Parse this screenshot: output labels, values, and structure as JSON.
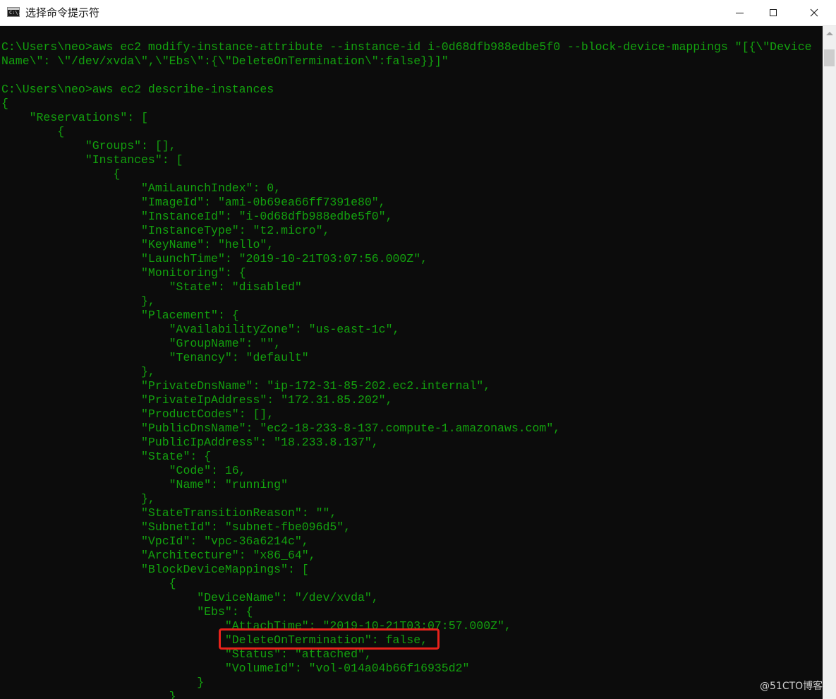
{
  "window": {
    "title": "选择命令提示符",
    "icon_name": "cmd-app-icon",
    "icon_glyph": "C:\\.",
    "controls": [
      "minimize",
      "maximize",
      "close"
    ],
    "close_glyph": "✕"
  },
  "console": {
    "text_color": "#13a10e",
    "background_color": "#0c0c0c",
    "lines": [
      "C:\\Users\\neo>aws ec2 modify-instance-attribute --instance-id i-0d68dfb988edbe5f0 --block-device-mappings \"[{\\\"Device",
      "Name\\\": \\\"/dev/xvda\\\",\\\"Ebs\\\":{\\\"DeleteOnTermination\\\":false}}]\"",
      "",
      "C:\\Users\\neo>aws ec2 describe-instances",
      "{",
      "    \"Reservations\": [",
      "        {",
      "            \"Groups\": [],",
      "            \"Instances\": [",
      "                {",
      "                    \"AmiLaunchIndex\": 0,",
      "                    \"ImageId\": \"ami-0b69ea66ff7391e80\",",
      "                    \"InstanceId\": \"i-0d68dfb988edbe5f0\",",
      "                    \"InstanceType\": \"t2.micro\",",
      "                    \"KeyName\": \"hello\",",
      "                    \"LaunchTime\": \"2019-10-21T03:07:56.000Z\",",
      "                    \"Monitoring\": {",
      "                        \"State\": \"disabled\"",
      "                    },",
      "                    \"Placement\": {",
      "                        \"AvailabilityZone\": \"us-east-1c\",",
      "                        \"GroupName\": \"\",",
      "                        \"Tenancy\": \"default\"",
      "                    },",
      "                    \"PrivateDnsName\": \"ip-172-31-85-202.ec2.internal\",",
      "                    \"PrivateIpAddress\": \"172.31.85.202\",",
      "                    \"ProductCodes\": [],",
      "                    \"PublicDnsName\": \"ec2-18-233-8-137.compute-1.amazonaws.com\",",
      "                    \"PublicIpAddress\": \"18.233.8.137\",",
      "                    \"State\": {",
      "                        \"Code\": 16,",
      "                        \"Name\": \"running\"",
      "                    },",
      "                    \"StateTransitionReason\": \"\",",
      "                    \"SubnetId\": \"subnet-fbe096d5\",",
      "                    \"VpcId\": \"vpc-36a6214c\",",
      "                    \"Architecture\": \"x86_64\",",
      "                    \"BlockDeviceMappings\": [",
      "                        {",
      "                            \"DeviceName\": \"/dev/xvda\",",
      "                            \"Ebs\": {",
      "                                \"AttachTime\": \"2019-10-21T03:07:57.000Z\",",
      "                                \"DeleteOnTermination\": false,",
      "                                \"Status\": \"attached\",",
      "                                \"VolumeId\": \"vol-014a04b66f16935d2\"",
      "                            }",
      "                        }"
    ]
  },
  "annotation": {
    "highlight_color": "#e8221b",
    "highlighted_text": "\"DeleteOnTermination\": false,"
  },
  "watermark": {
    "text": "@51CTO博客"
  }
}
